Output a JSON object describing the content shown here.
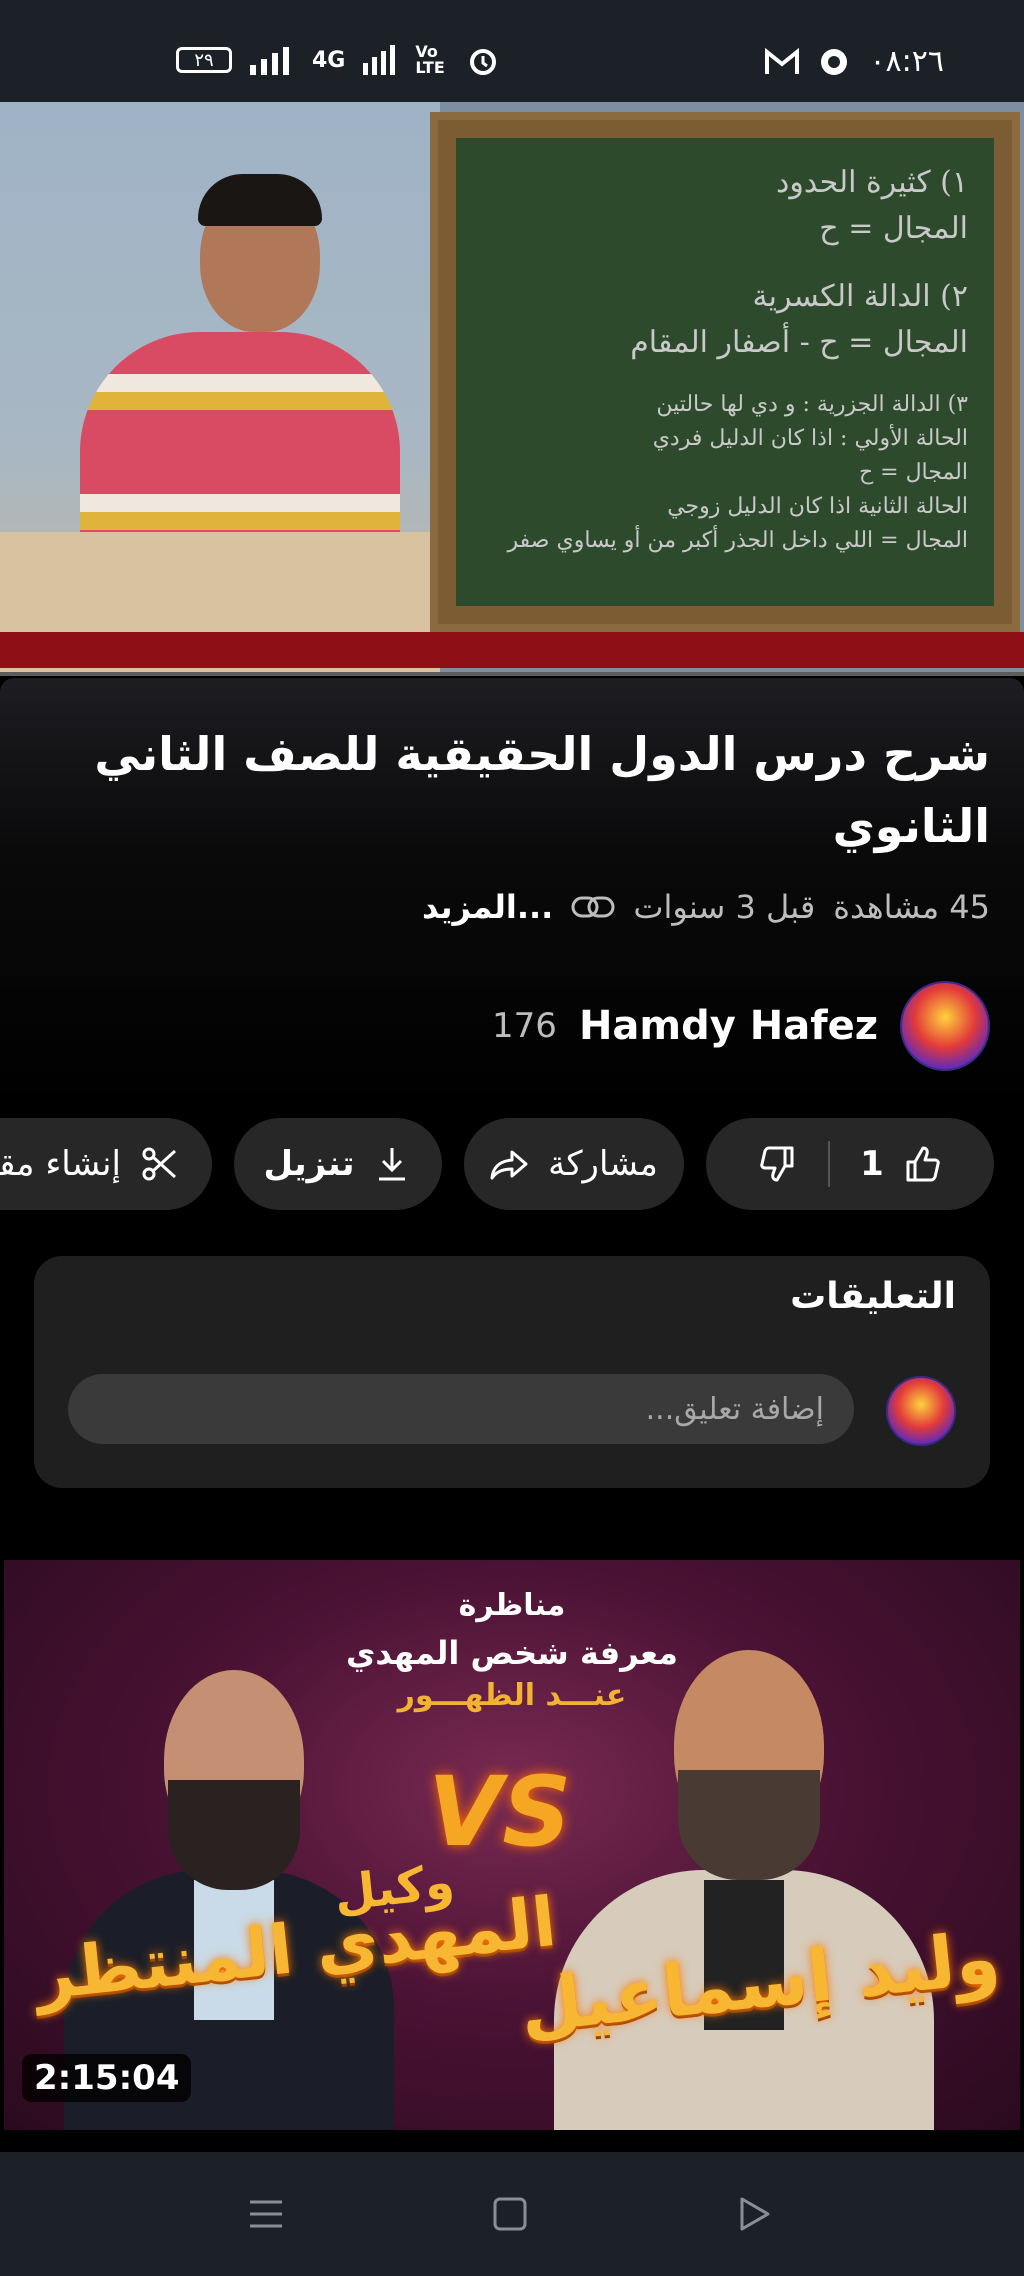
{
  "status_bar": {
    "time": "٠٨:٢٦",
    "battery": "٢٩",
    "network": "4G",
    "volte": "Vo LTE"
  },
  "video": {
    "board_lines_big": [
      "١) كثيرة الحدود",
      "المجال = ح",
      "٢) الدالة الكسرية",
      "المجال = ح - أصفار المقام"
    ],
    "board_lines_small": [
      "٣) الدالة الجزرية : و دي لها حالتين",
      "الحالة الأولي : اذا كان الدليل فردي",
      "المجال = ح",
      "الحالة الثانية اذا كان الدليل زوجي",
      "المجال = اللي داخل الجذر أكبر من أو يساوي صفر"
    ],
    "title": "شرح درس الدول الحقيقية للصف الثاني الثانوي",
    "views": "45 مشاهدة",
    "age": "قبل 3 سنوات",
    "more": "...المزيد"
  },
  "channel": {
    "name": "Hamdy Hafez",
    "subscribers": "176"
  },
  "actions": {
    "likes": "1",
    "share": "مشاركة",
    "download": "تنزيل",
    "clip": "إنشاء مقطع"
  },
  "comments": {
    "title": "التعليقات",
    "placeholder": "إضافة تعليق..."
  },
  "next_video": {
    "header": "مناظرة",
    "subtitle": "معرفة شخص المهدي",
    "subtitle2": "عنـــد الظهـــور",
    "vs": "VS",
    "name_right": "وليد إسماعيل",
    "name_left_top": "وكيل",
    "name_left": "المهدي المنتظر",
    "duration": "2:15:04"
  }
}
